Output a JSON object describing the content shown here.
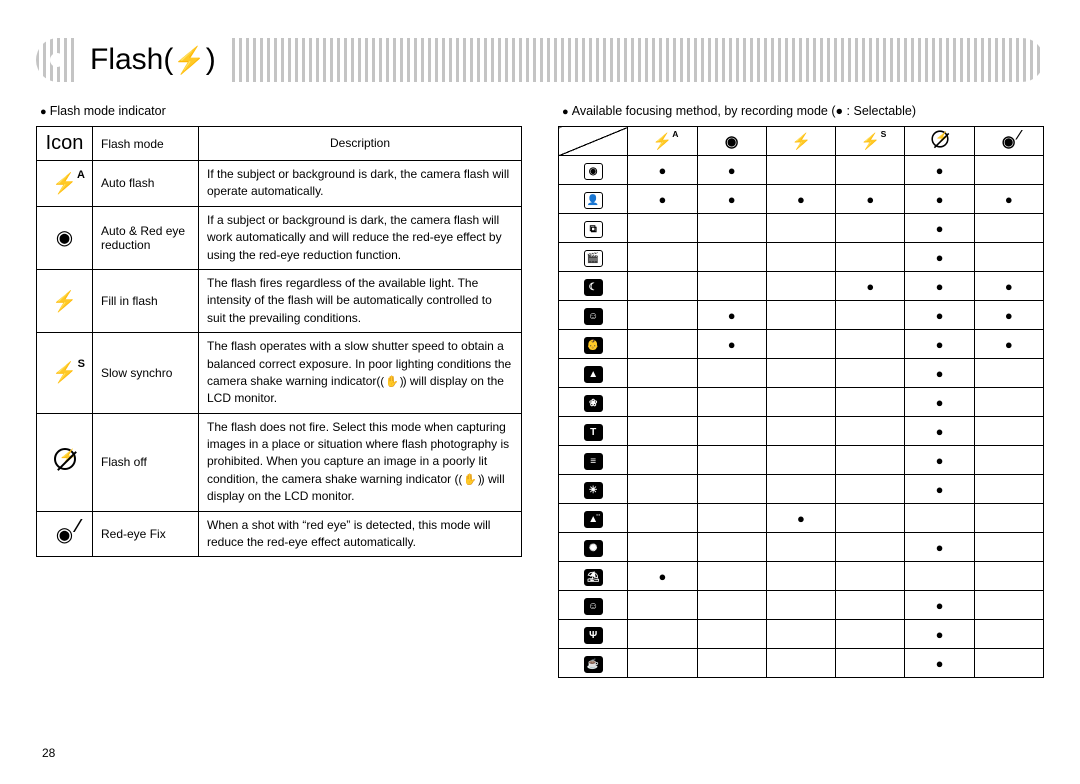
{
  "page_number": "28",
  "title": "Flash(",
  "title_tail": " )",
  "left": {
    "caption": "Flash mode indicator",
    "headers": {
      "icon": "Icon",
      "mode": "Flash mode",
      "desc": "Description"
    },
    "rows": [
      {
        "icon": "flash-a",
        "mode": "Auto flash",
        "desc": "If the subject or background is dark, the camera flash will operate automatically."
      },
      {
        "icon": "eye",
        "mode": "Auto & Red eye reduction",
        "desc": "If a subject or background is dark, the camera flash will work automatically and will reduce the red-eye effect by using the red-eye reduction function."
      },
      {
        "icon": "flash",
        "mode": "Fill in flash",
        "desc": "The flash fires regardless of the available light. The intensity of the flash will be automatically controlled to suit the prevailing conditions."
      },
      {
        "icon": "flash-s",
        "mode": "Slow synchro",
        "desc_pre": "The flash operates with a slow shutter speed to obtain a balanced correct exposure. In poor lighting conditions the camera shake warning indicator(",
        "desc_post": ") will display on the LCD monitor."
      },
      {
        "icon": "noflash",
        "mode": "Flash off",
        "desc_pre": "The flash does not fire. Select this mode when capturing images in a place or situation where flash photography is prohibited. When you capture an image in a poorly lit condition, the camera shake warning indicator (",
        "desc_post": ") will display on the LCD monitor."
      },
      {
        "icon": "eyefix",
        "mode": "Red-eye Fix",
        "desc": "When a shot with “red eye” is detected, this mode will reduce the red-eye effect automatically."
      }
    ]
  },
  "right": {
    "caption": "Available focusing method, by recording mode (● : Selectable)",
    "col_icons": [
      "flash-a",
      "eye",
      "flash",
      "flash-s",
      "noflash",
      "eyefix"
    ],
    "row_icons": [
      "camera",
      "camera-person",
      "dual",
      "clapper",
      "night",
      "portrait",
      "children",
      "landscape",
      "closeup",
      "text",
      "sunset",
      "dawn",
      "backlight",
      "firework",
      "beach",
      "selfshot",
      "food",
      "cafe"
    ],
    "row_glyphs": {
      "camera": "◉",
      "camera-person": "👤",
      "dual": "⧉",
      "clapper": "🎬",
      "night": "☾",
      "portrait": "☺",
      "children": "👶",
      "landscape": "▲",
      "closeup": "❀",
      "text": "T",
      "sunset": "≡",
      "dawn": "☀",
      "backlight": "▲̈",
      "firework": "✺",
      "beach": "⛱",
      "selfshot": "☺",
      "food": "Ψ",
      "cafe": "☕"
    },
    "row_inverted": [
      "night",
      "portrait",
      "children",
      "landscape",
      "closeup",
      "text",
      "sunset",
      "dawn",
      "backlight",
      "firework",
      "beach",
      "selfshot",
      "food",
      "cafe"
    ],
    "cells": [
      [
        1,
        1,
        0,
        0,
        1,
        0
      ],
      [
        1,
        1,
        1,
        1,
        1,
        1
      ],
      [
        0,
        0,
        0,
        0,
        1,
        0
      ],
      [
        0,
        0,
        0,
        0,
        1,
        0
      ],
      [
        0,
        0,
        0,
        1,
        1,
        1
      ],
      [
        0,
        1,
        0,
        0,
        1,
        1
      ],
      [
        0,
        1,
        0,
        0,
        1,
        1
      ],
      [
        0,
        0,
        0,
        0,
        1,
        0
      ],
      [
        0,
        0,
        0,
        0,
        1,
        0
      ],
      [
        0,
        0,
        0,
        0,
        1,
        0
      ],
      [
        0,
        0,
        0,
        0,
        1,
        0
      ],
      [
        0,
        0,
        0,
        0,
        1,
        0
      ],
      [
        0,
        0,
        1,
        0,
        0,
        0
      ],
      [
        0,
        0,
        0,
        0,
        1,
        0
      ],
      [
        1,
        0,
        0,
        0,
        0,
        0
      ],
      [
        0,
        0,
        0,
        0,
        1,
        0
      ],
      [
        0,
        0,
        0,
        0,
        1,
        0
      ],
      [
        0,
        0,
        0,
        0,
        1,
        0
      ]
    ]
  }
}
